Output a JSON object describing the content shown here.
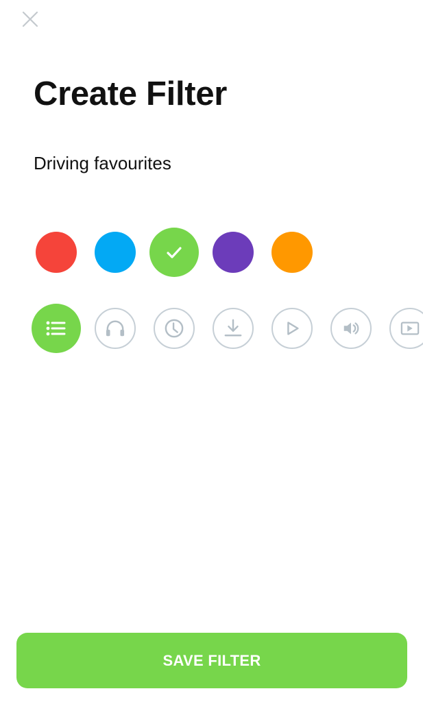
{
  "screen": {
    "title": "Create Filter",
    "filter_name": "Driving favourites",
    "close_icon": "close-icon"
  },
  "colors": {
    "options": [
      {
        "name": "red",
        "hex": "#f5443a",
        "selected": false
      },
      {
        "name": "blue",
        "hex": "#03a9f4",
        "selected": false
      },
      {
        "name": "green",
        "hex": "#77d64b",
        "selected": true
      },
      {
        "name": "purple",
        "hex": "#6c3cba",
        "selected": false
      },
      {
        "name": "orange",
        "hex": "#ff9800",
        "selected": false
      }
    ],
    "check_icon": "checkmark-icon"
  },
  "icons": {
    "options": [
      {
        "name": "list-icon",
        "selected": true
      },
      {
        "name": "headphones-icon",
        "selected": false
      },
      {
        "name": "clock-icon",
        "selected": false
      },
      {
        "name": "download-icon",
        "selected": false
      },
      {
        "name": "play-icon",
        "selected": false
      },
      {
        "name": "volume-icon",
        "selected": false
      },
      {
        "name": "video-icon",
        "selected": false
      }
    ],
    "accent": "#77d64b",
    "outline": "#c6cfd6",
    "glyph_color": "#b3bec6"
  },
  "footer": {
    "save_label": "SAVE FILTER"
  }
}
